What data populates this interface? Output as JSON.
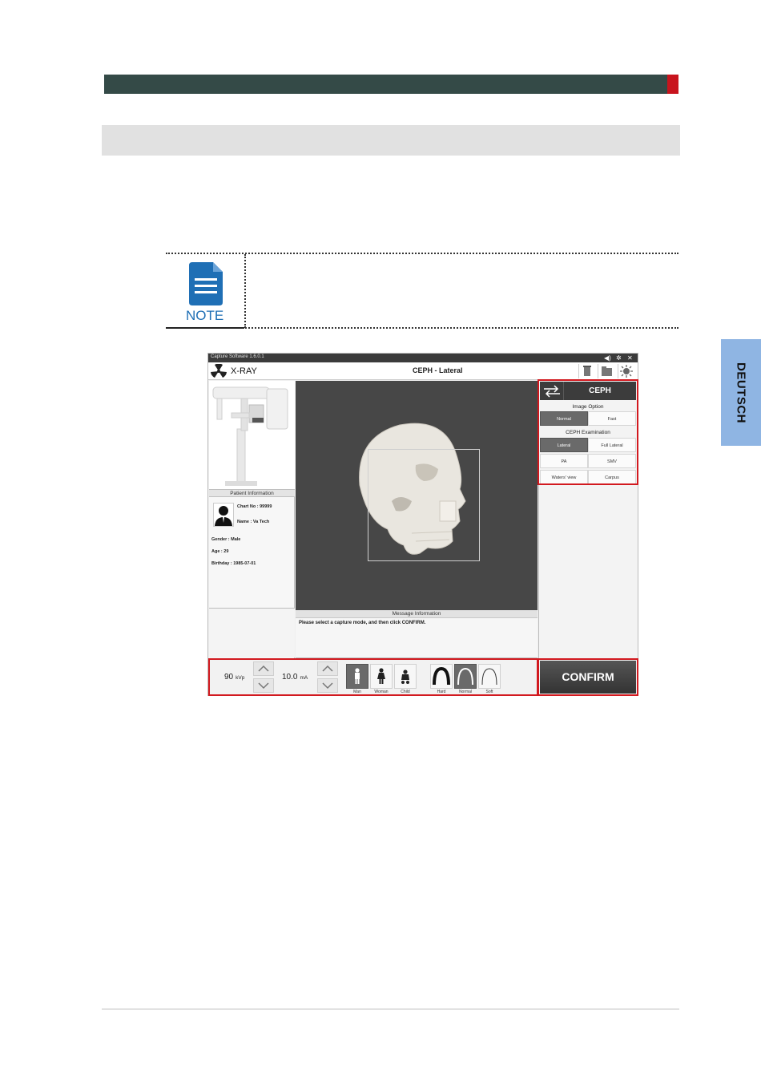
{
  "side_tab": {
    "label": "DEUTSCH"
  },
  "note": {
    "label": "NOTE"
  },
  "app": {
    "title": "Capture Software 1.6.0.1",
    "app_name": "X-RAY",
    "mode_title": "CEPH - Lateral",
    "window_controls": [
      "speaker-icon",
      "gear-icon",
      "close-icon"
    ],
    "patient": {
      "header": "Patient Information",
      "chart_no": "Chart No : 99999",
      "name": "Name : Va Tech",
      "gender": "Gender : Male",
      "age": "Age : 29",
      "birthday": "Birthday : 1985-07-01"
    },
    "message": {
      "header": "Message Information",
      "text": "Please select a capture mode, and then click CONFIRM."
    },
    "right": {
      "mode_label": "CEPH",
      "image_option_label": "Image Option",
      "image_options": [
        {
          "label": "Normal",
          "selected": true
        },
        {
          "label": "Fast",
          "selected": false
        }
      ],
      "exam_label": "CEPH Examination",
      "exams": [
        {
          "label": "Lateral",
          "selected": true
        },
        {
          "label": "Full Lateral",
          "selected": false
        },
        {
          "label": "PA",
          "selected": false
        },
        {
          "label": "SMV",
          "selected": false
        },
        {
          "label": "Waters' view",
          "selected": false
        },
        {
          "label": "Carpus",
          "selected": false
        }
      ]
    },
    "bottom": {
      "kvp_value": "90",
      "kvp_unit": "kVp",
      "ma_value": "10.0",
      "ma_unit": "mA",
      "patient_types": [
        {
          "label": "Man",
          "selected": true
        },
        {
          "label": "Woman",
          "selected": false
        },
        {
          "label": "Child",
          "selected": false
        }
      ],
      "arch_types": [
        {
          "label": "Hard",
          "selected": false
        },
        {
          "label": "Normal",
          "selected": true
        },
        {
          "label": "Soft",
          "selected": false
        }
      ],
      "confirm_label": "CONFIRM"
    }
  },
  "colors": {
    "header_bar": "#344a47",
    "accent_red": "#c8141d",
    "side_tab": "#8fb5e3",
    "note_blue": "#1f6fb5",
    "highlight_red": "#d2191f"
  }
}
